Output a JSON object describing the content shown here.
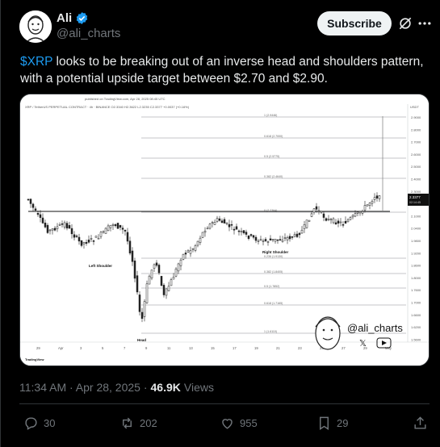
{
  "author": {
    "name": "Ali",
    "handle": "@ali_charts",
    "subscribe_label": "Subscribe"
  },
  "tweet": {
    "cashtag": "$XRP",
    "text_line1_rest": " looks to be breaking out of an inverse head and shoulders pattern,",
    "text_line2": "with a potential upside target between $2.70 and $2.90."
  },
  "chart": {
    "published": "published on TradingView.com, Apr 28, 2025 08:45 UTC",
    "symbol": "XRP / TetherUS PERPETUAL CONTRACT · 4h · BINANCE  O2.3340  H2.3622  L2.3235  C2.3377  +0.0037 (+0.16%)",
    "currency": "USDT",
    "fib_labels": [
      "1 (2.9446)",
      "0.618 (2.7000)",
      "0.5 (2.5775)",
      "0.382 (2.4640)",
      "0 (2.2364)",
      "0.236 (1.9130)",
      "0.382 (1.8405)",
      "0.5 (1.7852)",
      "0.618 (1.7165)",
      "1 (1.6110)"
    ],
    "price_ticks": [
      "2.9000",
      "2.8000",
      "2.7000",
      "2.6000",
      "2.5000",
      "2.4000",
      "2.3000",
      "2.2000",
      "2.1000",
      "2.0400",
      "1.9800",
      "1.9200",
      "1.8600",
      "1.8000",
      "1.7600",
      "1.7000",
      "1.6600",
      "1.6200",
      "1.5600"
    ],
    "last_price": "2.3377",
    "countdown": "02:14:45",
    "date_ticks": [
      "29",
      "Apr",
      "3",
      "5",
      "7",
      "9",
      "11",
      "13",
      "15",
      "17",
      "19",
      "21",
      "23",
      "25",
      "27",
      "29",
      "May"
    ],
    "annotations": {
      "left_shoulder": "Left Shoulder",
      "head": "Head",
      "right_shoulder": "Right Shoulder"
    },
    "watermark_handle": "@ali_charts",
    "tv_logo_text": "TradingView"
  },
  "meta": {
    "time": "11:34 AM · Apr 28, 2025 ·",
    "views_count": "46.9K",
    "views_label": "Views"
  },
  "actions": {
    "replies": "30",
    "reposts": "202",
    "likes": "955",
    "bookmarks": "29"
  },
  "colors": {
    "verified": "#1d9bf0",
    "accent": "#1d9bf0",
    "muted": "#71767b"
  }
}
